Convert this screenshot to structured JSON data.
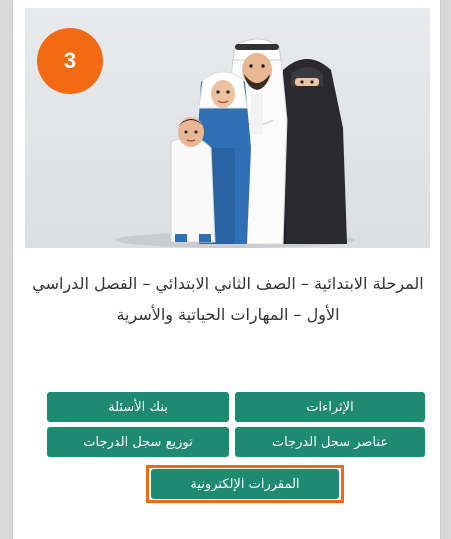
{
  "step_badge": "3",
  "course_title": "المرحلة الابتدائية – الصف الثاني الابتدائي – الفصل الدراسي الأول – المهارات الحياتية والأسرية",
  "buttons": {
    "enrichments": "الإثراءات",
    "question_bank": "بنك الأسئلة",
    "gradebook_elements": "عناصر سجل الدرجات",
    "gradebook_distribution": "توزيع سجل الدرجات",
    "e_courses": "المقررات الإلكترونية"
  },
  "illustration": {
    "icon": "family-illustration"
  },
  "colors": {
    "accent": "#f26a14",
    "button": "#1e8a72",
    "text": "#333333"
  }
}
